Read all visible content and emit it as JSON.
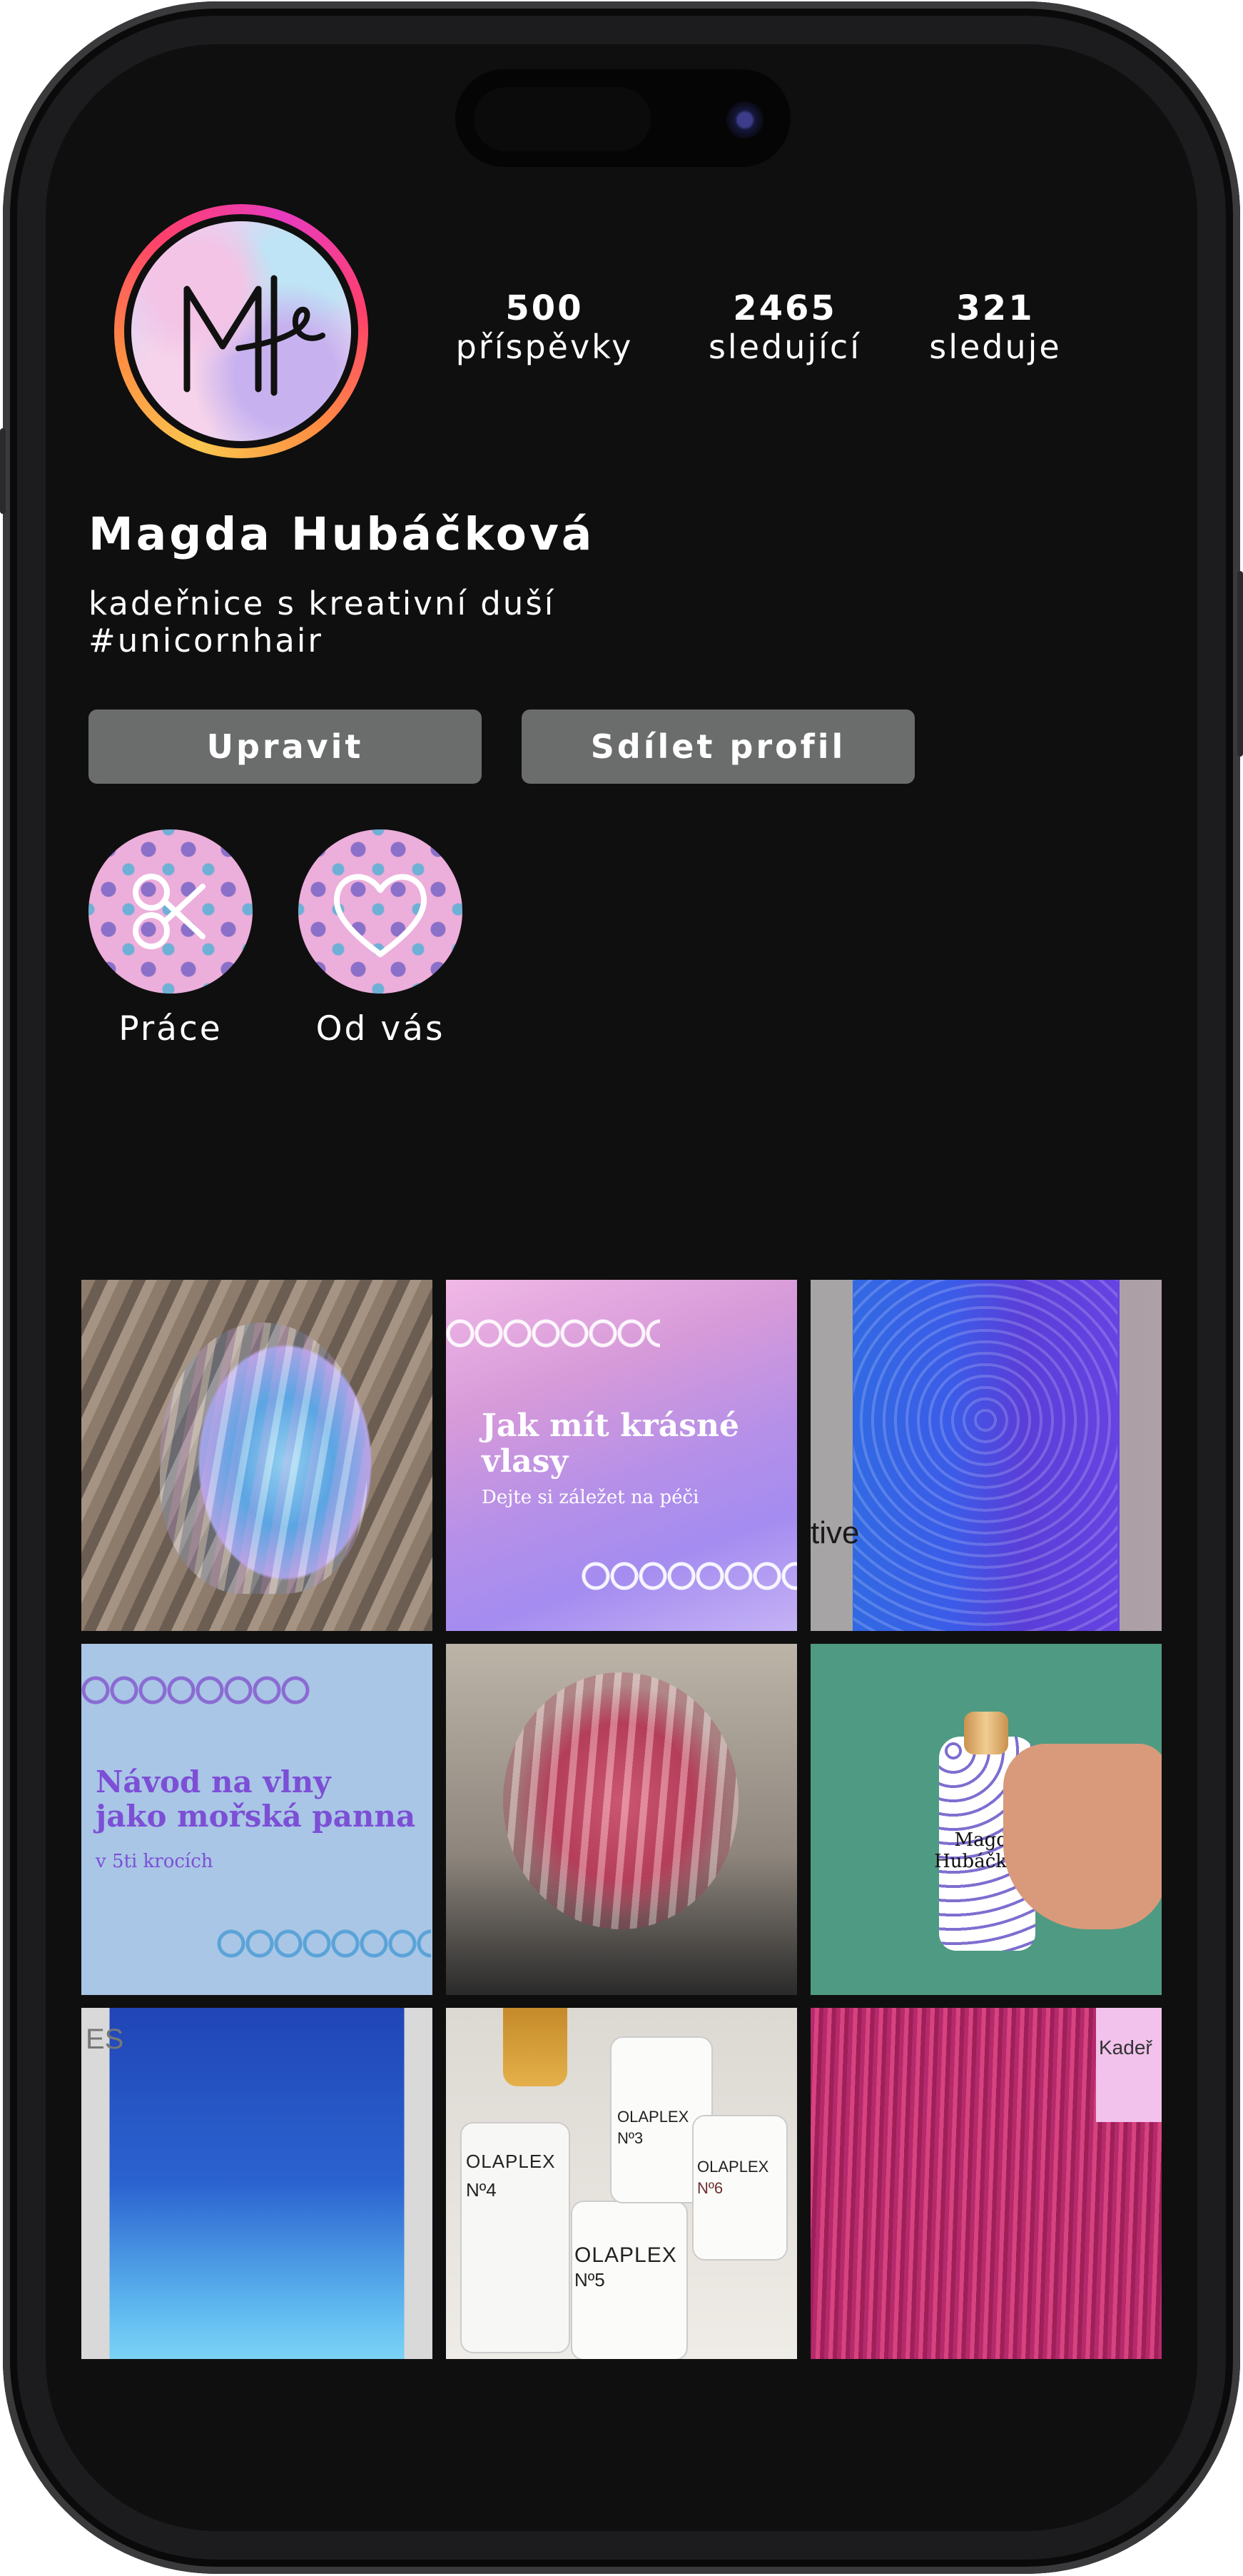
{
  "profile": {
    "name": "Magda Hubáčková",
    "bio_line1": "kadeřnice s kreativní duší",
    "bio_line2": "#unicornhair",
    "avatar_monogram": "MH",
    "avatar_icon": "mh-monogram-logo"
  },
  "stats": [
    {
      "value": "500",
      "label": "příspěvky"
    },
    {
      "value": "2465",
      "label": "sledující"
    },
    {
      "value": "321",
      "label": "sleduje"
    }
  ],
  "buttons": {
    "edit_label": "Upravit",
    "share_label": "Sdílet profil"
  },
  "highlights": [
    {
      "label": "Práce",
      "icon": "scissors-icon"
    },
    {
      "label": "Od vás",
      "icon": "heart-icon"
    }
  ],
  "posts": {
    "p2_title": "Jak mít krásné vlasy",
    "p2_subtitle": "Dejte si záležet na péči",
    "p3_overlay": "tive",
    "p4_title_line1": "Návod na vlny",
    "p4_title_line2": "jako mořská panna",
    "p4_subtitle": "v 5ti krocích",
    "p6_bottle_line1": "Magda",
    "p6_bottle_line2": "Hubáčková",
    "p7_sign": "ES",
    "p8_brand": "OLAPLEX",
    "p8_no4": "Nº4",
    "p8_no5": "Nº5",
    "p8_no3": "Nº3",
    "p8_no6": "Nº6",
    "p9_sign": "Kadeř"
  },
  "colors": {
    "background": "#0f0f0f",
    "button": "#6b6d6c",
    "text": "#ffffff"
  }
}
